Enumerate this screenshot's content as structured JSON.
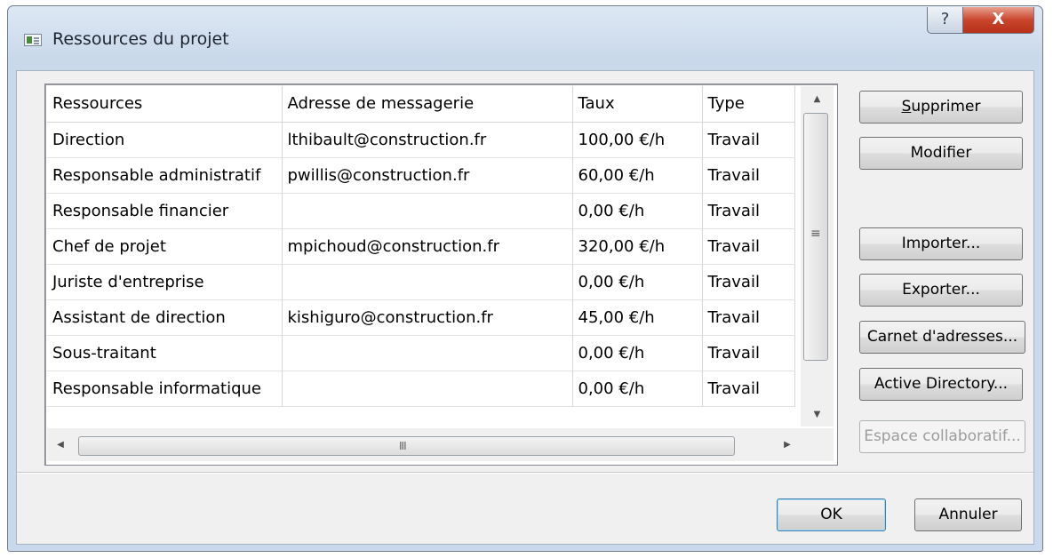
{
  "window": {
    "title": "Ressources du projet",
    "help_label": "?",
    "close_label": "X"
  },
  "table": {
    "columns": [
      "Ressources",
      "Adresse de messagerie",
      "Taux",
      "Type"
    ],
    "rows": [
      [
        "Direction",
        "lthibault@construction.fr",
        "100,00 €/h",
        "Travail"
      ],
      [
        "Responsable administratif",
        "pwillis@construction.fr",
        "60,00 €/h",
        "Travail"
      ],
      [
        "Responsable financier",
        "",
        "0,00 €/h",
        "Travail"
      ],
      [
        "Chef de projet",
        "mpichoud@construction.fr",
        "320,00 €/h",
        "Travail"
      ],
      [
        "Juriste d'entreprise",
        "",
        "0,00 €/h",
        "Travail"
      ],
      [
        "Assistant de direction",
        "kishiguro@construction.fr",
        "45,00 €/h",
        "Travail"
      ],
      [
        "Sous-traitant",
        "",
        "0,00 €/h",
        "Travail"
      ],
      [
        "Responsable informatique",
        "",
        "0,00 €/h",
        "Travail"
      ]
    ]
  },
  "scrollbars": {
    "grip_vertical": "≡",
    "grip_horizontal": "III"
  },
  "buttons": {
    "supprimer": {
      "accel": "S",
      "rest": "upprimer"
    },
    "modifier": "Modifier",
    "importer": "Importer...",
    "exporter": "Exporter...",
    "carnet": "Carnet d'adresses...",
    "active_directory": "Active Directory...",
    "espace": "Espace collaboratif...",
    "ok": "OK",
    "annuler": "Annuler"
  }
}
